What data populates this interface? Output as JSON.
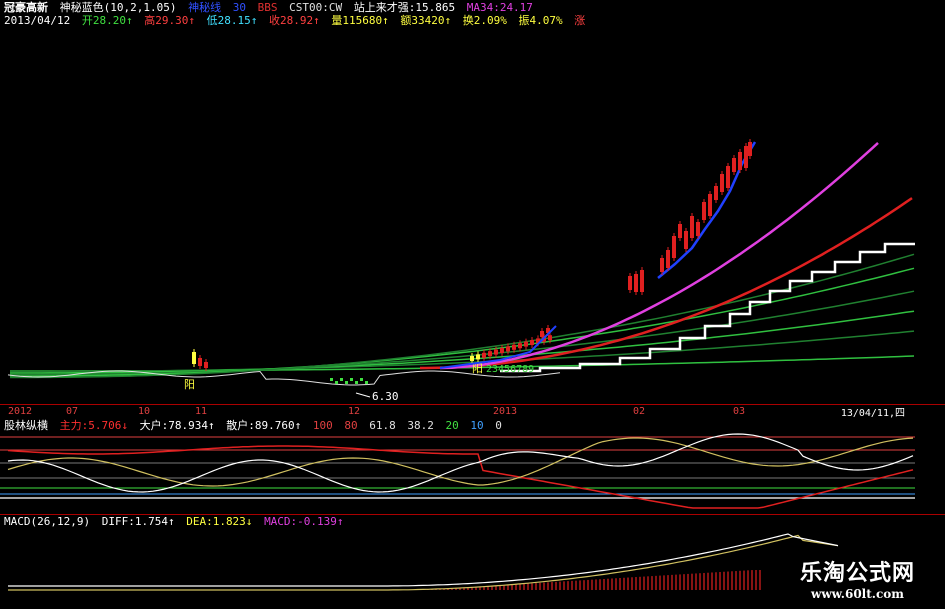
{
  "header": {
    "name": "冠豪高新",
    "indicator": "神秘蓝色(10,2,1.05)",
    "tag1": "神秘线",
    "tag2": "30",
    "tag3": "BBS",
    "tag4": "CST00:CW",
    "tag5": "站上来才强:15.865",
    "tag6": "MA34:24.17"
  },
  "quote": {
    "date": "2013/04/12",
    "open": "开28.20↑",
    "high": "高29.30↑",
    "low": "低28.15↑",
    "close": "收28.92↑",
    "volume": "量115680↑",
    "amount": "额33420↑",
    "turnover": "换2.09%",
    "amplitude": "振4.07%",
    "change": "涨"
  },
  "annotations": {
    "low_price": "6.30",
    "yang1": "阳",
    "yang2": "阳",
    "seq": "23456789"
  },
  "axis": {
    "labels": [
      "2012",
      "07",
      "10",
      "11",
      "12",
      "2013",
      "02",
      "03"
    ],
    "current_date": "13/04/11,四"
  },
  "indicator_panel": {
    "title": "股林纵横",
    "main": "主力:5.706↓",
    "big": "大户:78.934↑",
    "retail": "散户:89.760↑",
    "levels": [
      "100",
      "80",
      "61.8",
      "38.2",
      "20",
      "10",
      "0"
    ]
  },
  "macd_panel": {
    "title": "MACD(26,12,9)",
    "diff": "DIFF:1.754↑",
    "dea": "DEA:1.823↓",
    "macd": "MACD:-0.139↑"
  },
  "watermark": {
    "line1": "乐淘公式网",
    "line2": "www.60lt.com"
  },
  "colors": {
    "background": "#000000",
    "candle_up": "#e02020",
    "candle_top": "#ffff40",
    "trend_blue": "#2040ff",
    "magenta_line": "#e040e0",
    "red_line": "#e02020",
    "white_step": "#ffffff",
    "green_lines": "#30c040"
  },
  "chart_data": {
    "type": "line",
    "title": "冠豪高新",
    "x": [
      "2012",
      "07",
      "10",
      "11",
      "12",
      "2013",
      "02",
      "03",
      "13/04/11"
    ],
    "series": [
      {
        "name": "收",
        "values": [
          8.2,
          7.9,
          7.8,
          8.5,
          6.8,
          8.6,
          11.2,
          22.5,
          28.92
        ]
      },
      {
        "name": "MA34",
        "values": [
          8.1,
          8.0,
          7.9,
          8.0,
          7.6,
          8.1,
          9.8,
          16.5,
          24.17
        ]
      }
    ],
    "ylim": [
      5,
      32
    ]
  }
}
